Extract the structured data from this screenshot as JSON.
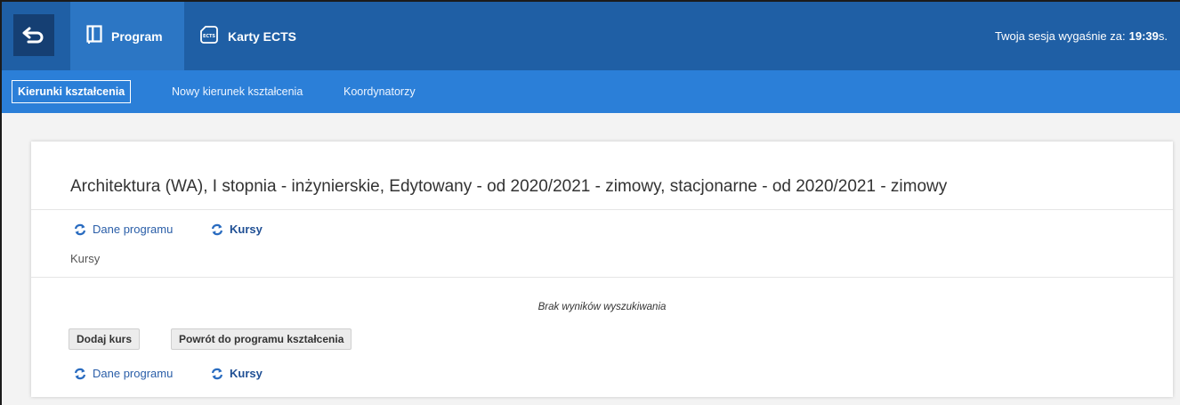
{
  "topbar": {
    "back_icon": "back-arrow-icon",
    "tabs": [
      {
        "label": "Program",
        "icon": "book-icon"
      },
      {
        "label": "Karty ECTS",
        "icon": "ects-card-icon"
      }
    ],
    "session_label": "Twoja sesja wygaśnie za:",
    "session_time": "19:39",
    "session_suffix": "s."
  },
  "subnav": {
    "items": [
      {
        "label": "Kierunki kształcenia",
        "active": true
      },
      {
        "label": "Nowy kierunek kształcenia"
      },
      {
        "label": "Koordynatorzy"
      }
    ]
  },
  "card": {
    "title": "Architektura (WA), I stopnia - inżynierskie, Edytowany - od 2020/2021 - zimowy, stacjonarne - od 2020/2021 - zimowy",
    "links_top": {
      "dane": "Dane programu",
      "kursy": "Kursy"
    },
    "section_label": "Kursy",
    "empty_message": "Brak wyników wyszukiwania",
    "buttons": {
      "add": "Dodaj kurs",
      "back": "Powrót do programu kształcenia"
    },
    "links_bottom": {
      "dane": "Dane programu",
      "kursy": "Kursy"
    }
  },
  "colors": {
    "topbar": "#1f5fa5",
    "subnav": "#2b7fd8",
    "active_tab": "#2c76c4",
    "link": "#2a5ea8"
  }
}
